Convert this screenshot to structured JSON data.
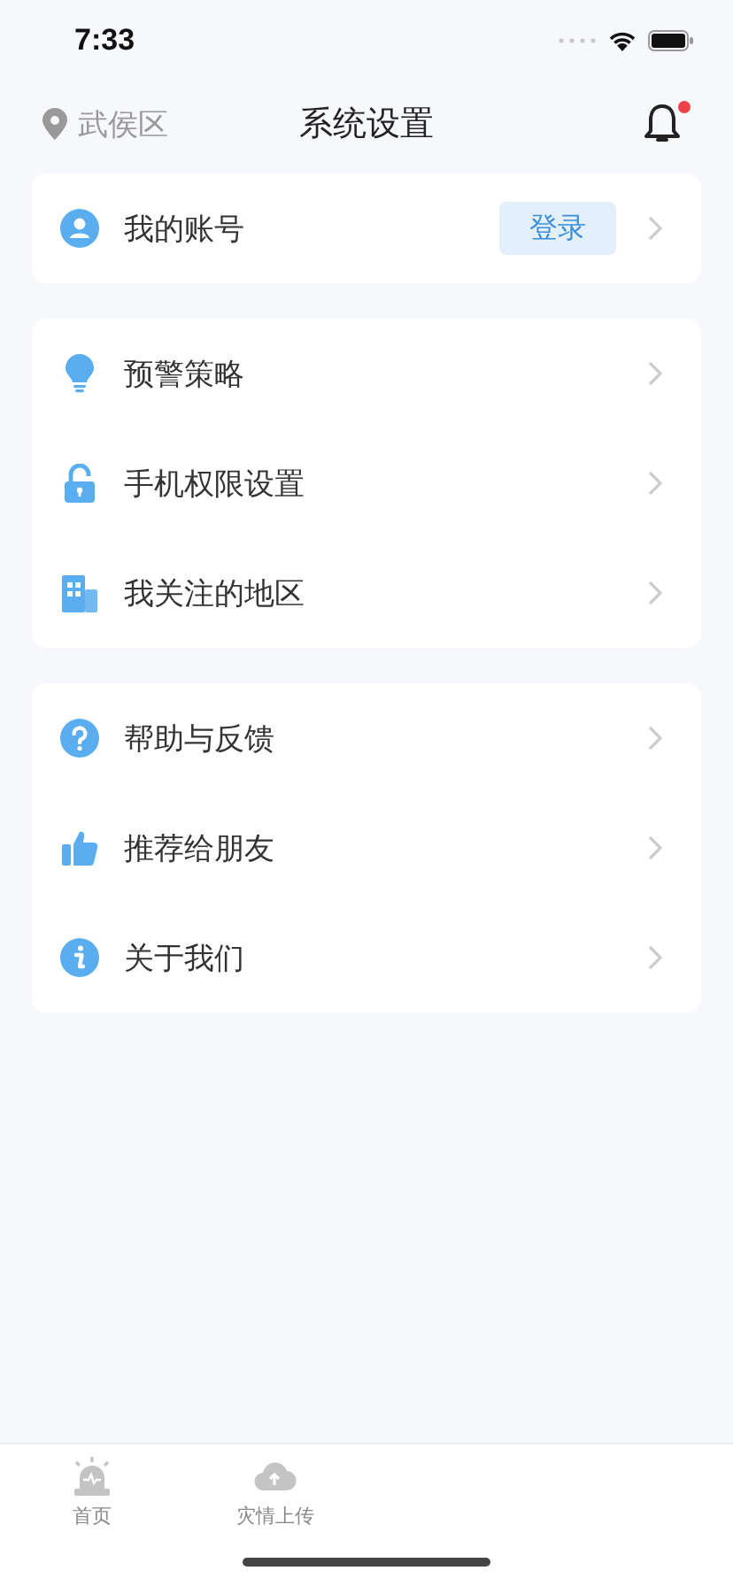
{
  "status_bar": {
    "time": "7:33"
  },
  "header": {
    "location": "武侯区",
    "title": "系统设置",
    "has_notification": true
  },
  "account": {
    "label": "我的账号",
    "login_button": "登录"
  },
  "groups": [
    {
      "items": [
        {
          "kind": "bulb",
          "label": "预警策略"
        },
        {
          "kind": "lock",
          "label": "手机权限设置"
        },
        {
          "kind": "building",
          "label": "我关注的地区"
        }
      ]
    },
    {
      "items": [
        {
          "kind": "help",
          "label": "帮助与反馈"
        },
        {
          "kind": "thumb",
          "label": "推荐给朋友"
        },
        {
          "kind": "info",
          "label": "关于我们"
        }
      ]
    }
  ],
  "tab_bar": [
    {
      "kind": "alarm",
      "label": "首页",
      "selected": false
    },
    {
      "kind": "cloud",
      "label": "灾情上传",
      "selected": false
    }
  ]
}
